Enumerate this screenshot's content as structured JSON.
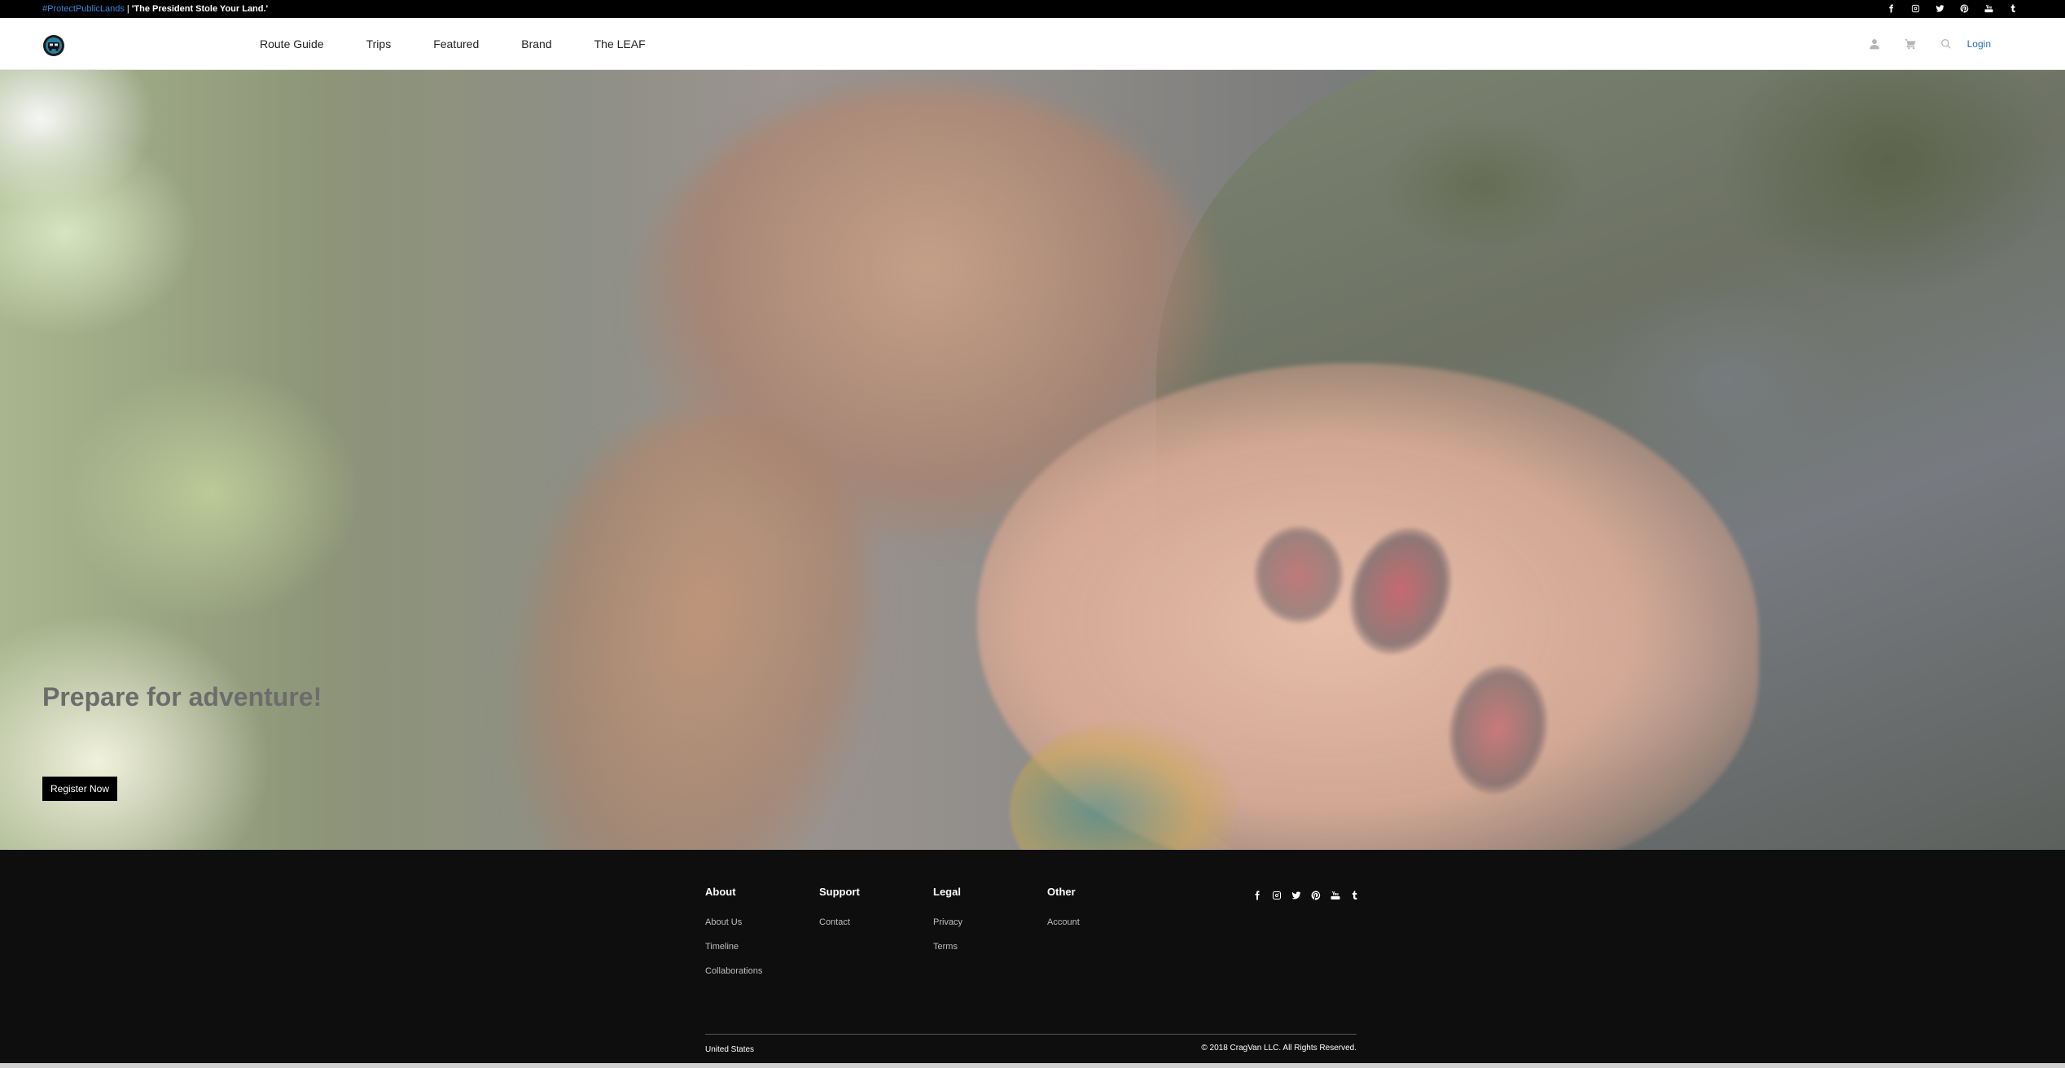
{
  "topbar": {
    "hashtag": "#ProtectPublicLands",
    "separator": "|",
    "quote": "'The President Stole Your Land.'",
    "social": [
      "facebook-icon",
      "instagram-icon",
      "twitter-icon",
      "pinterest-icon",
      "youtube-icon",
      "tumblr-icon"
    ]
  },
  "nav": {
    "links": [
      "Route Guide",
      "Trips",
      "Featured",
      "Brand",
      "The LEAF"
    ],
    "login": "Login",
    "icons": [
      "user-icon",
      "cart-icon",
      "search-icon"
    ]
  },
  "hero": {
    "headline": "Prepare for adventure!",
    "cta": "Register Now"
  },
  "footer": {
    "columns": [
      {
        "title": "About",
        "links": [
          "About Us",
          "Timeline",
          "Collaborations"
        ]
      },
      {
        "title": "Support",
        "links": [
          "Contact"
        ]
      },
      {
        "title": "Legal",
        "links": [
          "Privacy",
          "Terms"
        ]
      },
      {
        "title": "Other",
        "links": [
          "Account"
        ]
      }
    ],
    "social": [
      "facebook-icon",
      "instagram-icon",
      "twitter-icon",
      "pinterest-icon",
      "youtube-icon",
      "tumblr-icon"
    ],
    "locale": "United States",
    "copyright": "© 2018 CragVan LLC. All Rights Reserved."
  },
  "colors": {
    "accent_link": "#2b6db5",
    "hashtag": "#3a86d6",
    "footer_bg": "#0e0e0e",
    "button_bg": "#000000"
  }
}
